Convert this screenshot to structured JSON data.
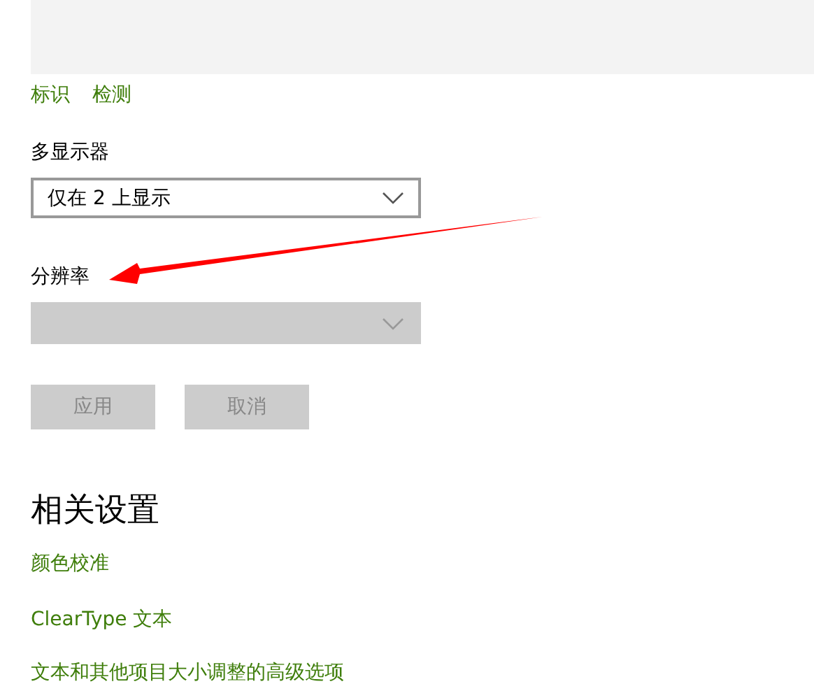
{
  "links": [
    {
      "label": "标识"
    },
    {
      "label": "检测"
    }
  ],
  "multi_display": {
    "label": "多显示器",
    "value": "仅在 2 上显示",
    "disabled": false
  },
  "resolution": {
    "label": "分辨率",
    "disabled": true
  },
  "buttons": [
    {
      "label": "应用",
      "disabled": true
    },
    {
      "label": "取消",
      "disabled": true
    }
  ],
  "related": {
    "title": "相关设置",
    "links": [
      {
        "label": "颜色校准"
      },
      {
        "label": "ClearType 文本"
      },
      {
        "label": "文本和其他项目大小调整的高级选项"
      }
    ]
  }
}
